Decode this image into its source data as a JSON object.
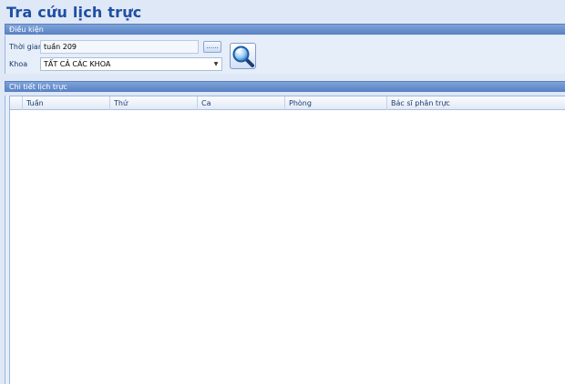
{
  "title": "Tra cứu lịch trực",
  "conditions": {
    "header": "Điều kiện",
    "time_label": "Thời gian",
    "time_value": "tuần 209",
    "ellipsis": "......",
    "dept_label": "Khoa",
    "dept_value": "TẤT CẢ CÁC KHOA"
  },
  "details": {
    "header": "Chi tiết lịch trực",
    "columns": [
      "Tuần",
      "Thứ",
      "Ca",
      "Phòng",
      "Bác sĩ phân trực"
    ]
  },
  "icons": {
    "search": "magnifier-icon",
    "dropdown": "chevron-down-icon"
  },
  "colors": {
    "header_gradient_top": "#7fa3d8",
    "header_gradient_bottom": "#5b84c6",
    "title": "#1f4fa3",
    "background": "#dfe8f6"
  }
}
